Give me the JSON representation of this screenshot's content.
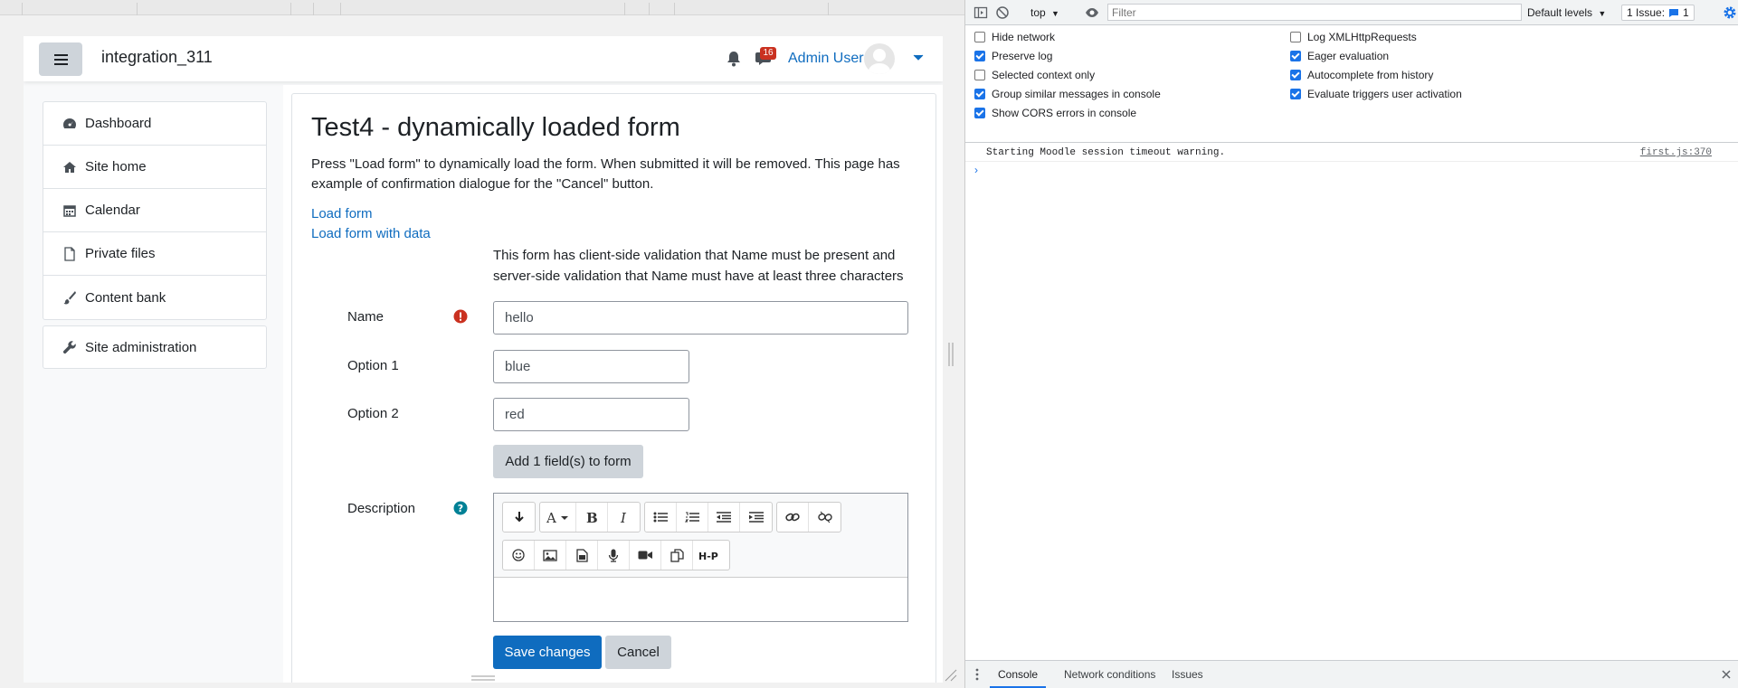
{
  "navbar": {
    "site_name": "integration_311",
    "message_count": "16",
    "user_name": "Admin User"
  },
  "nav": {
    "items": [
      {
        "label": "Dashboard",
        "icon": "dashboard-icon"
      },
      {
        "label": "Site home",
        "icon": "home-icon"
      },
      {
        "label": "Calendar",
        "icon": "calendar-icon"
      },
      {
        "label": "Private files",
        "icon": "file-icon"
      },
      {
        "label": "Content bank",
        "icon": "paintbrush-icon"
      }
    ],
    "admin": {
      "label": "Site administration",
      "icon": "wrench-icon"
    }
  },
  "page": {
    "title": "Test4 - dynamically loaded form",
    "intro": "Press \"Load form\" to dynamically load the form. When submitted it will be removed. This page has example of confirmation dialogue for the \"Cancel\" button.",
    "links": {
      "load_form": "Load form",
      "load_form_with_data": "Load form with data"
    }
  },
  "form": {
    "note": "This form has client-side validation that Name must be present and server-side validation that Name must have at least three characters",
    "name": {
      "label": "Name",
      "value": "hello"
    },
    "option1": {
      "label": "Option 1",
      "value": "blue"
    },
    "option2": {
      "label": "Option 2",
      "value": "red"
    },
    "add_field_label": "Add 1 field(s) to form",
    "description": {
      "label": "Description"
    },
    "editor_toolbar": {
      "row1": [
        [
          "collapse-icon"
        ],
        [
          "font-style-icon",
          "bold-icon",
          "italic-icon"
        ],
        [
          "bullet-list-icon",
          "numbered-list-icon",
          "outdent-icon",
          "indent-icon"
        ],
        [
          "link-icon",
          "unlink-icon"
        ]
      ],
      "row2": [
        [
          "emoji-icon",
          "image-icon",
          "media-file-icon",
          "microphone-icon",
          "video-icon",
          "copy-icon",
          "h5p-icon"
        ]
      ]
    },
    "h5p_label": "H-P",
    "save_label": "Save changes",
    "cancel_label": "Cancel"
  },
  "devtools": {
    "context": "top",
    "filter_placeholder": "Filter",
    "levels_label": "Default levels",
    "issues_label": "1 Issue:",
    "issues_count": "1",
    "settings": [
      {
        "label": "Hide network",
        "checked": false
      },
      {
        "label": "Log XMLHttpRequests",
        "checked": false
      },
      {
        "label": "Preserve log",
        "checked": true
      },
      {
        "label": "Eager evaluation",
        "checked": true
      },
      {
        "label": "Selected context only",
        "checked": false
      },
      {
        "label": "Autocomplete from history",
        "checked": true
      },
      {
        "label": "Group similar messages in console",
        "checked": true
      },
      {
        "label": "Evaluate triggers user activation",
        "checked": true
      },
      {
        "label": "Show CORS errors in console",
        "checked": true
      }
    ],
    "console_message": "Starting Moodle session timeout warning.",
    "console_source": "first.js:370",
    "prompt": "›",
    "drawer_tabs": [
      "Console",
      "Network conditions",
      "Issues"
    ]
  },
  "colors": {
    "link": "#0f6cbf",
    "primary": "#0f6cbf",
    "error": "#ca3120",
    "help": "#008196",
    "devtools_accent": "#1a73e8"
  }
}
